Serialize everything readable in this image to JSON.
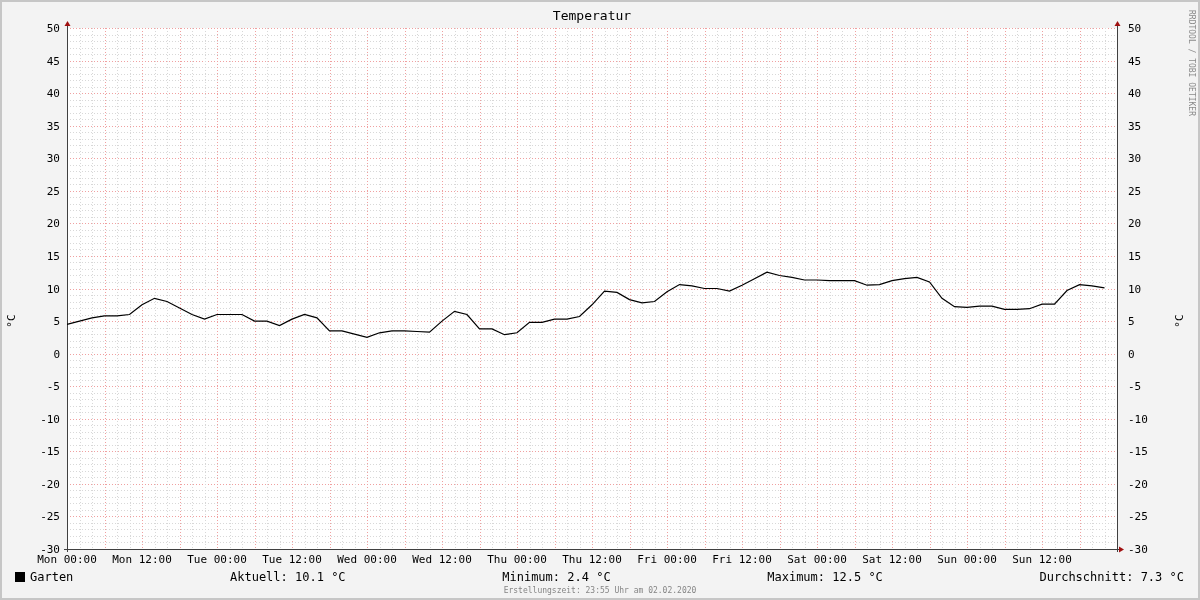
{
  "graph": {
    "credit": "RRDTOOL / TOBI OETIKER",
    "right_axis": {
      "label": "°C",
      "ticks": [
        "50",
        "45",
        "40",
        "35",
        "30",
        "25",
        "20",
        "15",
        "10",
        "5",
        "0",
        "-5",
        "-10",
        "-15",
        "-20",
        "-25",
        "-30"
      ]
    },
    "chart_data": {
      "type": "line",
      "title": "Temperatur",
      "ylabel": "°C",
      "categories": [
        "Mon 00:00",
        null,
        null,
        null,
        null,
        null,
        "Mon 12:00",
        null,
        null,
        null,
        null,
        null,
        "Tue 00:00",
        null,
        null,
        null,
        null,
        null,
        "Tue 12:00",
        null,
        null,
        null,
        null,
        null,
        "Wed 00:00",
        null,
        null,
        null,
        null,
        null,
        "Wed 12:00",
        null,
        null,
        null,
        null,
        null,
        "Thu 00:00",
        null,
        null,
        null,
        null,
        null,
        "Thu 12:00",
        null,
        null,
        null,
        null,
        null,
        "Fri 00:00",
        null,
        null,
        null,
        null,
        null,
        "Fri 12:00",
        null,
        null,
        null,
        null,
        null,
        "Sat 00:00",
        null,
        null,
        null,
        null,
        null,
        "Sat 12:00",
        null,
        null,
        null,
        null,
        null,
        "Sun 00:00",
        null,
        null,
        null,
        null,
        null,
        "Sun 12:00",
        null,
        null,
        null,
        null,
        null
      ],
      "series": [
        {
          "name": "Garten",
          "color": "#000000",
          "values": [
            4.5,
            5,
            5.5,
            5.8,
            5.8,
            6,
            7.5,
            8.5,
            8,
            7,
            6,
            5.3,
            6,
            6,
            6,
            5,
            5,
            4.3,
            5.3,
            6,
            5.5,
            3.5,
            3.5,
            3,
            2.5,
            3.2,
            3.5,
            3.5,
            3.4,
            3.3,
            5,
            6.5,
            6,
            3.8,
            3.8,
            2.9,
            3.2,
            4.8,
            4.8,
            5.3,
            5.3,
            5.7,
            7.5,
            9.6,
            9.4,
            8.3,
            7.8,
            8,
            9.5,
            10.6,
            10.4,
            10,
            10,
            9.6,
            10.5,
            11.5,
            12.5,
            12,
            11.7,
            11.3,
            11.3,
            11.2,
            11.2,
            11.2,
            10.5,
            10.6,
            11.2,
            11.5,
            11.7,
            11,
            8.5,
            7.2,
            7.1,
            7.3,
            7.3,
            6.8,
            6.8,
            6.9,
            7.6,
            7.6,
            9.7,
            10.6,
            10.4,
            10.1
          ]
        }
      ],
      "grid": true,
      "ylim": [
        -30,
        50
      ],
      "yticks": [
        50,
        45,
        40,
        35,
        30,
        25,
        20,
        15,
        10,
        5,
        0,
        -5,
        -10,
        -15,
        -20,
        -25,
        -30
      ]
    }
  },
  "legend": {
    "stats": [
      "Aktuell: 10.1 °C",
      "Minimum: 2.4 °C",
      "Maximum: 12.5 °C",
      "Durchschnitt: 7.3 °C"
    ]
  },
  "footer": "Erstellungszeit: 23:55 Uhr am 02.02.2020"
}
